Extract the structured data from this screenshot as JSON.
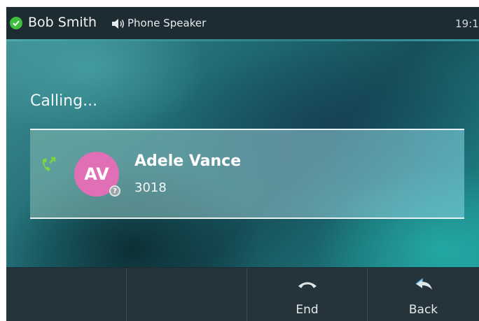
{
  "status_bar": {
    "user_name": "Bob Smith",
    "audio_mode": "Phone Speaker",
    "time": "19:1"
  },
  "main": {
    "call_state": "Calling...",
    "contact": {
      "initials": "AV",
      "name": "Adele Vance",
      "number": "3018",
      "presence_badge": "?"
    }
  },
  "softkeys": {
    "key1": {
      "label": ""
    },
    "key2": {
      "label": ""
    },
    "key3": {
      "label": "End",
      "icon": "end-call-icon"
    },
    "key4": {
      "label": "Back",
      "icon": "back-arrow-icon"
    }
  },
  "colors": {
    "presence_available": "#3ebf3e",
    "avatar": "#e16fb6",
    "call_icon": "#7fd63a"
  }
}
